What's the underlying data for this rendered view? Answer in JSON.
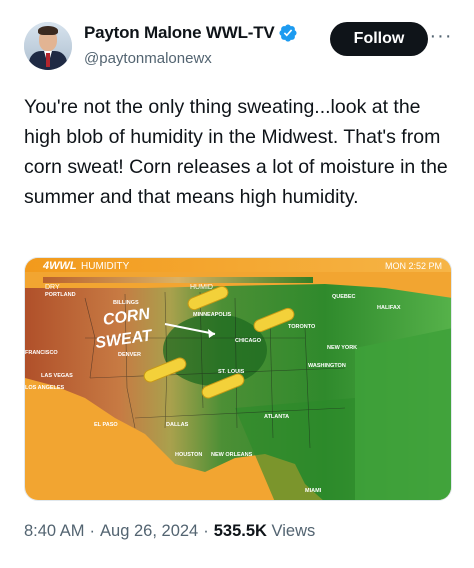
{
  "author": {
    "display_name": "Payton Malone WWL-TV",
    "handle": "@paytonmalonewx",
    "verified_icon": "verified-badge-icon"
  },
  "actions": {
    "follow_label": "Follow",
    "more_label": "···"
  },
  "tweet": {
    "text": "You're not the only thing sweating...look at the high blob of humidity in the Midwest. That's from corn sweat! Corn releases a lot of moisture in the summer and that means high humidity."
  },
  "media": {
    "station": "4WWL",
    "banner_title": "HUMIDITY",
    "time": "MON 2:52 PM",
    "scale_dry": "DRY",
    "scale_humid": "HUMID",
    "corn_label_line1": "CORN",
    "corn_label_line2": "SWEAT",
    "cities": {
      "portland": "PORTLAND",
      "billings": "BILLINGS",
      "minneapolis": "MINNEAPOLIS",
      "quebec": "QUEBEC",
      "halifax": "HALIFAX",
      "toronto": "TORONTO",
      "chicago": "CHICAGO",
      "new_york": "NEW YORK",
      "san_francisco": "FRANCISCO",
      "denver": "DENVER",
      "washington": "WASHINGTON",
      "st_louis": "ST. LOUIS",
      "las_vegas": "LAS VEGAS",
      "los_angeles": "LOS ANGELES",
      "atlanta": "ATLANTA",
      "el_paso": "EL PASO",
      "dallas": "DALLAS",
      "houston": "HOUSTON",
      "new_orleans": "NEW ORLEANS",
      "miami": "MIAMI"
    },
    "colors": {
      "dry": "#b35a2c",
      "humid": "#1f7a24",
      "banner": "#e58a12"
    }
  },
  "footer": {
    "time": "8:40 AM",
    "date": "Aug 26, 2024",
    "views_count": "535.5K",
    "views_label": "Views",
    "separator": "·"
  }
}
